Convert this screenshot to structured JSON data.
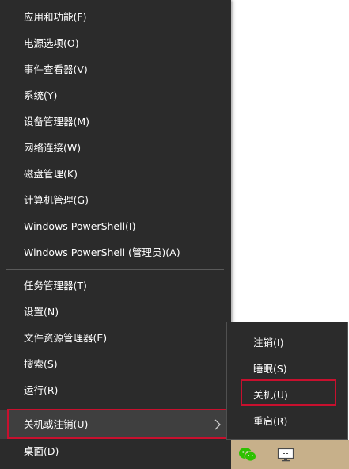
{
  "menu": {
    "items": [
      {
        "label": "应用和功能(F)"
      },
      {
        "label": "电源选项(O)"
      },
      {
        "label": "事件查看器(V)"
      },
      {
        "label": "系统(Y)"
      },
      {
        "label": "设备管理器(M)"
      },
      {
        "label": "网络连接(W)"
      },
      {
        "label": "磁盘管理(K)"
      },
      {
        "label": "计算机管理(G)"
      },
      {
        "label": "Windows PowerShell(I)"
      },
      {
        "label": "Windows PowerShell (管理员)(A)"
      },
      {
        "label": "任务管理器(T)"
      },
      {
        "label": "设置(N)"
      },
      {
        "label": "文件资源管理器(E)"
      },
      {
        "label": "搜索(S)"
      },
      {
        "label": "运行(R)"
      },
      {
        "label": "关机或注销(U)"
      },
      {
        "label": "桌面(D)"
      }
    ]
  },
  "submenu": {
    "items": [
      {
        "label": "注销(I)"
      },
      {
        "label": "睡眠(S)"
      },
      {
        "label": "关机(U)"
      },
      {
        "label": "重启(R)"
      }
    ]
  },
  "taskbar": {
    "icons": [
      "wechat-icon",
      "monitor-icon"
    ],
    "colors": {
      "taskbar_bg": "#c7b08a",
      "wechat_green": "#2dc100"
    }
  },
  "colors": {
    "menu_bg": "#2b2b2b",
    "separator": "#5a5a5a",
    "highlight_outline": "#c8102e",
    "text": "#ffffff"
  }
}
